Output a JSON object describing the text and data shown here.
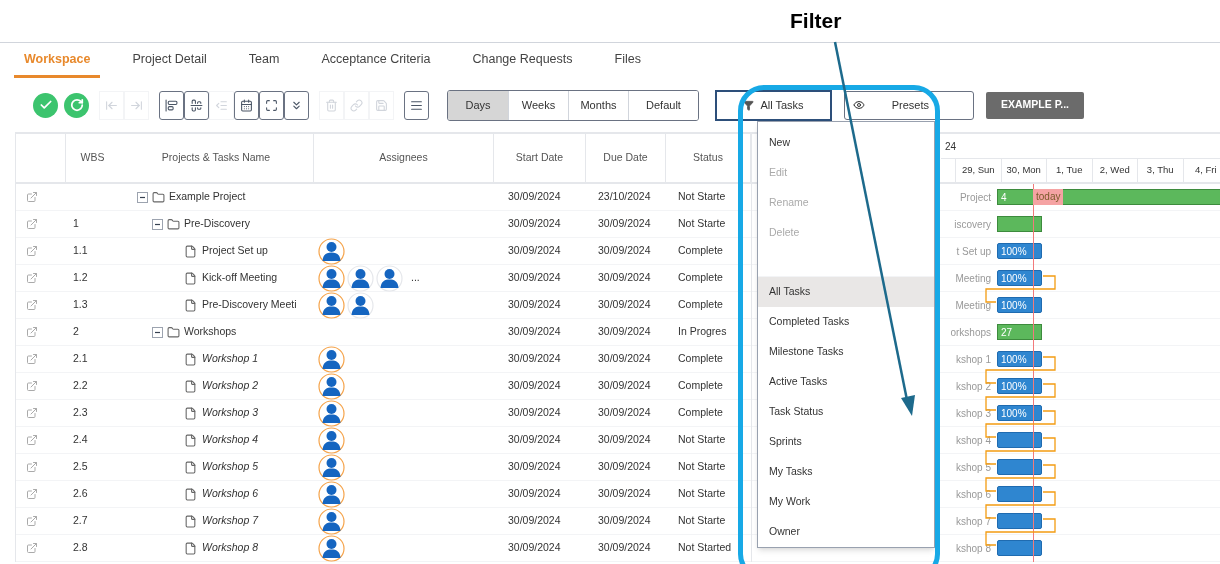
{
  "annotation": {
    "label": "Filter"
  },
  "tabs": [
    {
      "label": "Workspace",
      "selected": true
    },
    {
      "label": "Project Detail",
      "selected": false
    },
    {
      "label": "Team",
      "selected": false
    },
    {
      "label": "Acceptance Criteria",
      "selected": false
    },
    {
      "label": "Change Requests",
      "selected": false
    },
    {
      "label": "Files",
      "selected": false
    }
  ],
  "toolbar": {
    "actions": [
      {
        "kind": "confirm"
      },
      {
        "kind": "refresh"
      }
    ],
    "groups": [
      [
        {
          "kind": "insert-left",
          "disabled": true
        },
        {
          "kind": "insert-right",
          "disabled": true
        }
      ],
      [
        {
          "kind": "align-left",
          "disabled": false
        },
        {
          "kind": "align-center",
          "disabled": false
        },
        {
          "kind": "outdent",
          "disabled": true
        },
        {
          "kind": "calendar",
          "disabled": false
        },
        {
          "kind": "expand",
          "disabled": false
        },
        {
          "kind": "chevrons-down",
          "disabled": false
        }
      ],
      [
        {
          "kind": "delete",
          "disabled": true
        },
        {
          "kind": "link",
          "disabled": true
        },
        {
          "kind": "save",
          "disabled": true
        }
      ],
      [
        {
          "kind": "list",
          "disabled": false
        }
      ]
    ],
    "scales": [
      {
        "label": "Days",
        "selected": true
      },
      {
        "label": "Weeks",
        "selected": false
      },
      {
        "label": "Months",
        "selected": false
      },
      {
        "label": "Default",
        "selected": false
      }
    ],
    "filter": {
      "label": "All Tasks"
    },
    "presets": {
      "label": "Presets"
    },
    "project_button": {
      "label": "EXAMPLE P..."
    }
  },
  "table": {
    "columns": [
      "WBS",
      "Projects & Tasks Name",
      "Assignees",
      "Start Date",
      "Due Date",
      "Status"
    ],
    "rows": [
      {
        "kind": "folder",
        "wbs": "",
        "name": "Example Project",
        "expanded": true,
        "start": "30/09/2024",
        "due": "23/10/2024",
        "status": "Not Starte",
        "gantt_label": "Project",
        "bar_text": "4",
        "children": [
          {
            "kind": "folder",
            "wbs": "1",
            "name": "Pre-Discovery",
            "expanded": true,
            "start": "30/09/2024",
            "due": "30/09/2024",
            "status": "Not Starte",
            "gantt_label": "iscovery",
            "children": [
              {
                "kind": "task",
                "wbs": "1.1",
                "name": "Project Set up",
                "start": "30/09/2024",
                "due": "30/09/2024",
                "status": "Complete",
                "assignees": [
                  {
                    "highlighted": true
                  }
                ],
                "gantt_label": "t Set up",
                "bar_text": "100%"
              },
              {
                "kind": "task",
                "wbs": "1.2",
                "name": "Kick-off Meeting",
                "start": "30/09/2024",
                "due": "30/09/2024",
                "status": "Complete",
                "assignees": [
                  {
                    "highlighted": true
                  },
                  {
                    "highlighted": false
                  },
                  {
                    "highlighted": false
                  }
                ],
                "more": "...",
                "gantt_label": "Meeting",
                "bar_text": "100%"
              },
              {
                "kind": "task",
                "wbs": "1.3",
                "name": "Pre-Discovery Meeti",
                "start": "30/09/2024",
                "due": "30/09/2024",
                "status": "Complete",
                "assignees": [
                  {
                    "highlighted": true
                  },
                  {
                    "highlighted": false
                  }
                ],
                "gantt_label": "Meeting",
                "bar_text": "100%"
              }
            ]
          },
          {
            "kind": "folder",
            "wbs": "2",
            "name": "Workshops",
            "expanded": true,
            "start": "30/09/2024",
            "due": "30/09/2024",
            "status": "In Progres",
            "gantt_label": "orkshops",
            "bar_text": "27",
            "children": [
              {
                "kind": "task",
                "wbs": "2.1",
                "name": "Workshop 1",
                "start": "30/09/2024",
                "due": "30/09/2024",
                "status": "Complete",
                "assignees": [
                  {
                    "highlighted": true
                  }
                ],
                "gantt_label": "kshop 1",
                "bar_text": "100%"
              },
              {
                "kind": "task",
                "wbs": "2.2",
                "name": "Workshop 2",
                "start": "30/09/2024",
                "due": "30/09/2024",
                "status": "Complete",
                "assignees": [
                  {
                    "highlighted": true
                  }
                ],
                "gantt_label": "kshop 2",
                "bar_text": "100%"
              },
              {
                "kind": "task",
                "wbs": "2.3",
                "name": "Workshop 3",
                "start": "30/09/2024",
                "due": "30/09/2024",
                "status": "Complete",
                "assignees": [
                  {
                    "highlighted": true
                  }
                ],
                "gantt_label": "kshop 3",
                "bar_text": "100%"
              },
              {
                "kind": "task",
                "wbs": "2.4",
                "name": "Workshop 4",
                "start": "30/09/2024",
                "due": "30/09/2024",
                "status": "Not Starte",
                "assignees": [
                  {
                    "highlighted": true
                  }
                ],
                "gantt_label": "kshop 4"
              },
              {
                "kind": "task",
                "wbs": "2.5",
                "name": "Workshop 5",
                "start": "30/09/2024",
                "due": "30/09/2024",
                "status": "Not Starte",
                "assignees": [
                  {
                    "highlighted": true
                  }
                ],
                "gantt_label": "kshop 5"
              },
              {
                "kind": "task",
                "wbs": "2.6",
                "name": "Workshop 6",
                "start": "30/09/2024",
                "due": "30/09/2024",
                "status": "Not Starte",
                "assignees": [
                  {
                    "highlighted": true
                  }
                ],
                "gantt_label": "kshop 6"
              },
              {
                "kind": "task",
                "wbs": "2.7",
                "name": "Workshop 7",
                "start": "30/09/2024",
                "due": "30/09/2024",
                "status": "Not Starte",
                "assignees": [
                  {
                    "highlighted": true
                  }
                ],
                "gantt_label": "kshop 7"
              },
              {
                "kind": "task",
                "wbs": "2.8",
                "name": "Workshop 8",
                "start": "30/09/2024",
                "due": "30/09/2024",
                "status": "Not Started",
                "assignees": [
                  {
                    "highlighted": true
                  }
                ],
                "gantt_label": "kshop 8"
              }
            ]
          }
        ]
      }
    ]
  },
  "gantt": {
    "period": "24",
    "days": [
      "29, Sun",
      "30, Mon",
      "1, Tue",
      "2, Wed",
      "3, Thu",
      "4, Fri"
    ],
    "today_label": "today"
  },
  "filter_menu": {
    "items": [
      {
        "label": "New",
        "kind": "action",
        "disabled": false,
        "selected": false
      },
      {
        "label": "Edit",
        "kind": "action",
        "disabled": true,
        "selected": false
      },
      {
        "label": "Rename",
        "kind": "action",
        "disabled": true,
        "selected": false
      },
      {
        "label": "Delete",
        "kind": "action",
        "disabled": true,
        "selected": false
      },
      {
        "kind": "divider"
      },
      {
        "label": "All Tasks",
        "kind": "filter",
        "disabled": false,
        "selected": true
      },
      {
        "label": "Completed Tasks",
        "kind": "filter",
        "disabled": false,
        "selected": false
      },
      {
        "label": "Milestone Tasks",
        "kind": "filter",
        "disabled": false,
        "selected": false
      },
      {
        "label": "Active Tasks",
        "kind": "filter",
        "disabled": false,
        "selected": false
      },
      {
        "label": "Task Status",
        "kind": "filter",
        "disabled": false,
        "selected": false
      },
      {
        "label": "Sprints",
        "kind": "filter",
        "disabled": false,
        "selected": false
      },
      {
        "label": "My Tasks",
        "kind": "filter",
        "disabled": false,
        "selected": false
      },
      {
        "label": "My Work",
        "kind": "filter",
        "disabled": false,
        "selected": false
      },
      {
        "label": "Owner",
        "kind": "filter",
        "disabled": false,
        "selected": false
      }
    ]
  }
}
